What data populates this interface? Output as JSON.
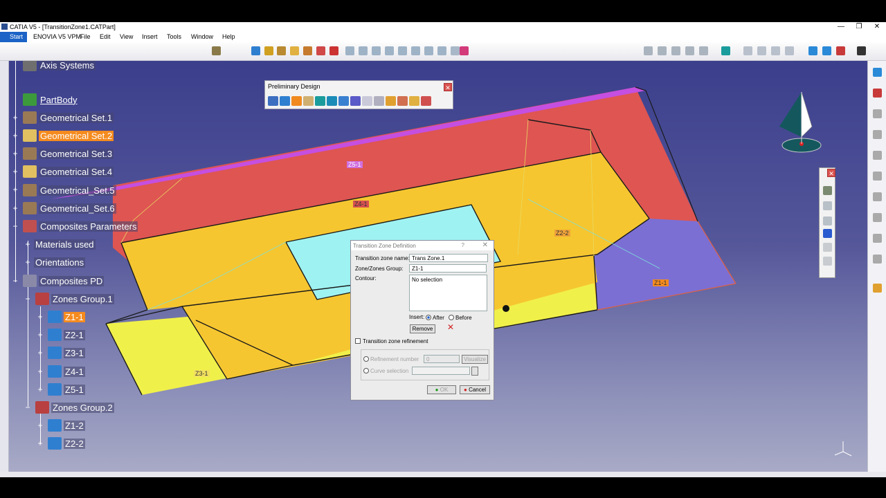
{
  "window": {
    "title": "CATIA V5 - [TransitionZone1.CATPart]"
  },
  "menu": {
    "items": [
      "Start",
      "ENOVIA V5 VPM",
      "File",
      "Edit",
      "View",
      "Insert",
      "Tools",
      "Window",
      "Help"
    ]
  },
  "tree": {
    "nodes": [
      {
        "label": "Axis Systems"
      },
      {
        "label": "PartBody"
      },
      {
        "label": "Geometrical Set.1"
      },
      {
        "label": "Geometrical Set.2"
      },
      {
        "label": "Geometrical Set.3"
      },
      {
        "label": "Geometrical Set.4"
      },
      {
        "label": "Geometrical_Set.5"
      },
      {
        "label": "Geometrical_Set.6"
      },
      {
        "label": "Composites Parameters"
      },
      {
        "label": "Materials used"
      },
      {
        "label": "Orientations"
      },
      {
        "label": "Composites PD"
      },
      {
        "label": "Zones Group.1"
      },
      {
        "label": "Z1-1"
      },
      {
        "label": "Z2-1"
      },
      {
        "label": "Z3-1"
      },
      {
        "label": "Z4-1"
      },
      {
        "label": "Z5-1"
      },
      {
        "label": "Zones Group.2"
      },
      {
        "label": "Z1-2"
      },
      {
        "label": "Z2-2"
      }
    ]
  },
  "zone_labels": [
    "Z5-1",
    "Z4-1",
    "Z2-2",
    "Z1-1",
    "Z3-1"
  ],
  "preliminary_toolbar": {
    "title": "Preliminary Design"
  },
  "dialog": {
    "title": "Transition Zone Definition",
    "help": "?",
    "close": "✕",
    "name_label": "Transition zone name:",
    "name_value": "Trans Zone.1",
    "zone_label": "Zone/Zones Group:",
    "zone_value": "Z1-1",
    "contour_label": "Contour:",
    "contour_value": "No selection",
    "insert_label": "Insert:",
    "after_label": "After",
    "before_label": "Before",
    "remove_label": "Remove",
    "refinement_label": "Transition zone refinement",
    "refinement_number_label": "Refinement number",
    "refinement_number_value": "0",
    "visualize_label": "Visualize",
    "curve_selection_label": "Curve selection",
    "ok_label": "OK",
    "cancel_label": "Cancel"
  },
  "colors": {
    "red_zone": "#de5552",
    "yellow_zone": "#f6c630",
    "light_yellow_zone": "#f0f04a",
    "cyan_zone": "#9ff2f2",
    "purple_zone": "#7b6fd4",
    "selection": "#f58b1f",
    "background_top": "#3b3f8c"
  }
}
